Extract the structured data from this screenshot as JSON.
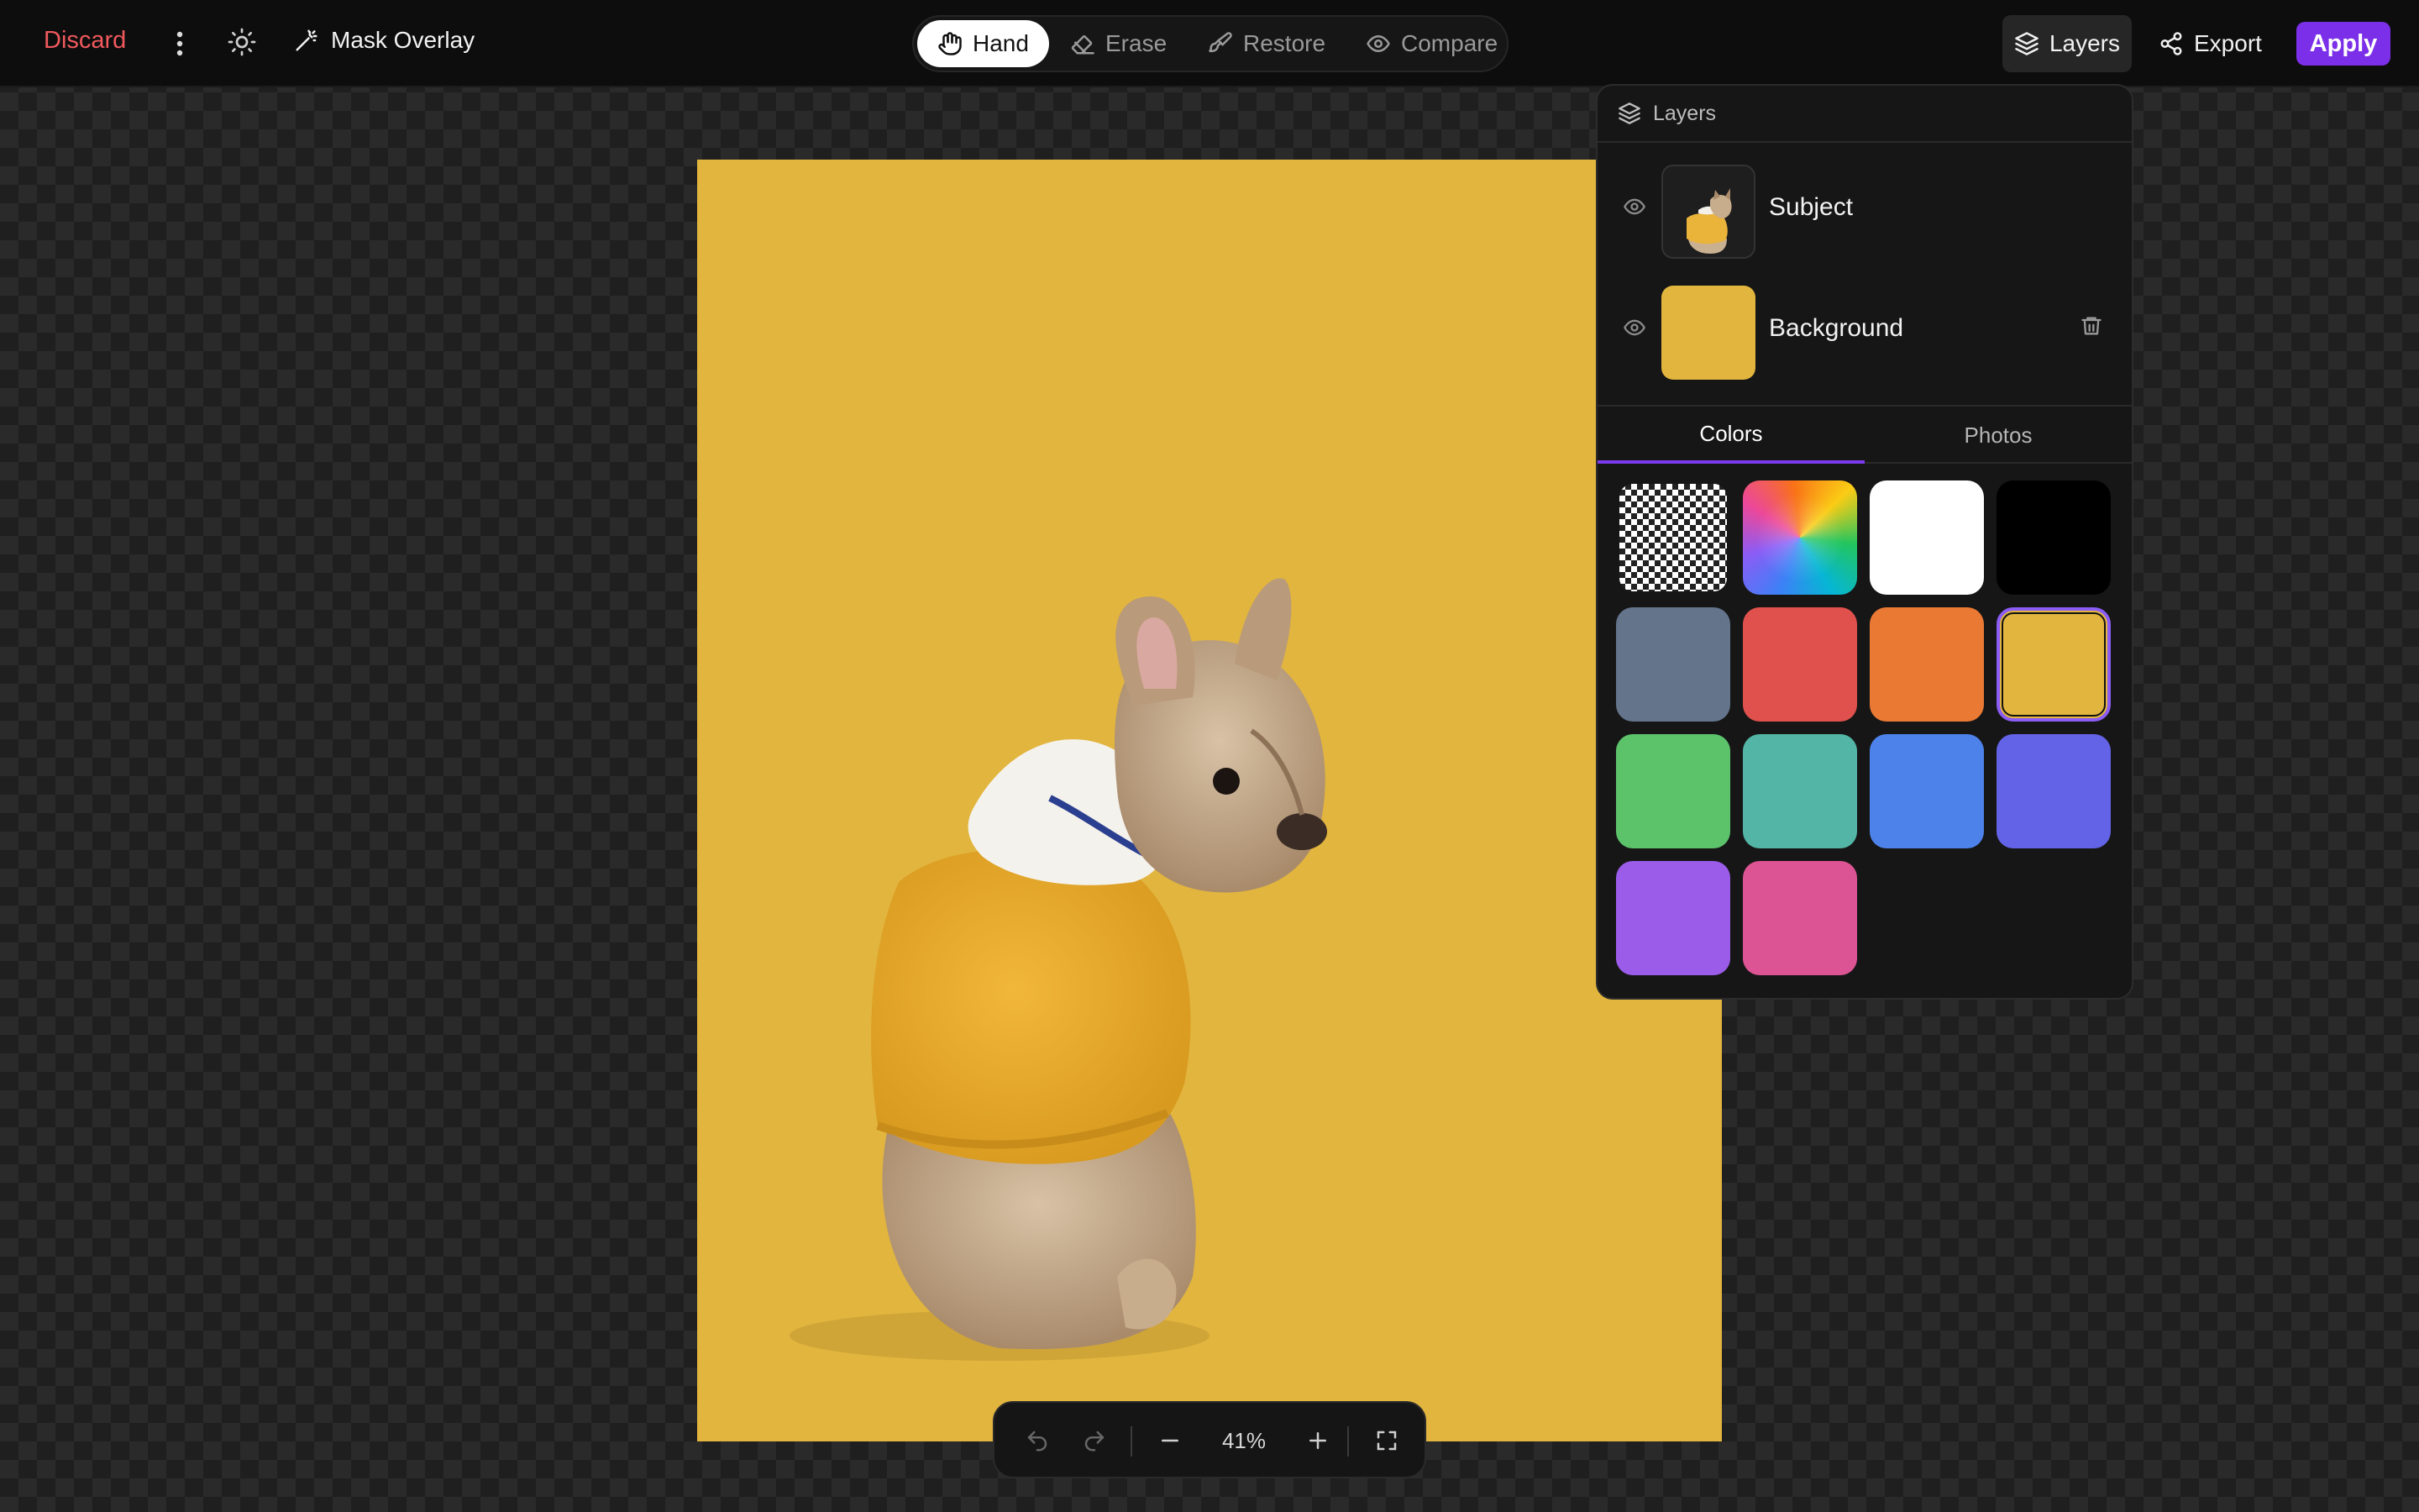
{
  "topbar": {
    "discard_label": "Discard",
    "mask_overlay_label": "Mask Overlay",
    "tools": [
      {
        "label": "Hand",
        "icon": "hand-icon",
        "active": true
      },
      {
        "label": "Erase",
        "icon": "eraser-icon",
        "active": false
      },
      {
        "label": "Restore",
        "icon": "brush-icon",
        "active": false
      },
      {
        "label": "Compare",
        "icon": "eye-icon",
        "active": false
      }
    ],
    "layers_label": "Layers",
    "export_label": "Export",
    "apply_label": "Apply"
  },
  "canvas": {
    "background_color": "#e2b53e"
  },
  "zoom": {
    "value": "41%"
  },
  "layers_panel": {
    "title": "Layers",
    "layers": [
      {
        "name": "Subject",
        "visible": true
      },
      {
        "name": "Background",
        "visible": true,
        "color": "#e2b53e"
      }
    ],
    "tabs": [
      "Colors",
      "Photos"
    ],
    "active_tab": "Colors",
    "swatches": [
      {
        "name": "transparent"
      },
      {
        "name": "gradient"
      },
      {
        "name": "white",
        "color": "#ffffff"
      },
      {
        "name": "black",
        "color": "#000000"
      },
      {
        "name": "slate",
        "color": "#64748b"
      },
      {
        "name": "red",
        "color": "#e0514d"
      },
      {
        "name": "orange",
        "color": "#ea7934"
      },
      {
        "name": "yellow",
        "color": "#e2b53e",
        "selected": true
      },
      {
        "name": "green",
        "color": "#5cc36b"
      },
      {
        "name": "teal",
        "color": "#52b5a5"
      },
      {
        "name": "blue",
        "color": "#4d82ea"
      },
      {
        "name": "indigo",
        "color": "#6363e7"
      },
      {
        "name": "purple",
        "color": "#9a5ce9"
      },
      {
        "name": "pink",
        "color": "#dc5494"
      }
    ]
  }
}
